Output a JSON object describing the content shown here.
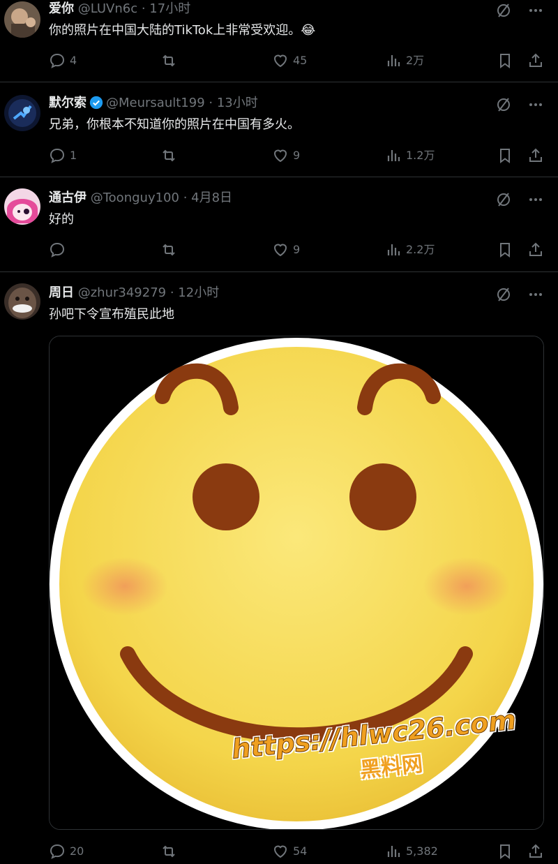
{
  "posts": [
    {
      "name": "爱你",
      "handle": "@LUVn6c",
      "time": "· 17小时",
      "text": "你的照片在中国大陆的TikTok上非常受欢迎。😂",
      "replies": "4",
      "reposts": "",
      "likes": "45",
      "views": "2万",
      "verified": false
    },
    {
      "name": "默尔索",
      "handle": "@Meursault199",
      "time": "· 13小时",
      "text": "兄弟，你根本不知道你的照片在中国有多火。",
      "replies": "1",
      "reposts": "",
      "likes": "9",
      "views": "1.2万",
      "verified": true
    },
    {
      "name": "通古伊",
      "handle": "@Toonguy100",
      "time": "· 4月8日",
      "text": "好的",
      "replies": "",
      "reposts": "",
      "likes": "9",
      "views": "2.2万",
      "verified": false
    },
    {
      "name": "周日",
      "handle": "@zhur349279",
      "time": "· 12小时",
      "text": "孙吧下令宣布殖民此地",
      "replies": "20",
      "reposts": "",
      "likes": "54",
      "views": "5,382",
      "verified": false
    }
  ],
  "watermark": {
    "url": "https://hlwc26.com",
    "label": "黑料网"
  },
  "colors": {
    "background": "#000000",
    "text": "#e7e9ea",
    "muted": "#71767b",
    "divider": "#2f3336",
    "verified": "#1d9bf0",
    "emoji_face": "#f6d84a",
    "emoji_feature": "#8a3a10",
    "watermark": "#f0a020"
  },
  "icons": [
    "grok-icon",
    "more-icon",
    "reply-icon",
    "repost-icon",
    "like-icon",
    "views-icon",
    "bookmark-icon",
    "share-icon",
    "verified-badge-icon"
  ]
}
